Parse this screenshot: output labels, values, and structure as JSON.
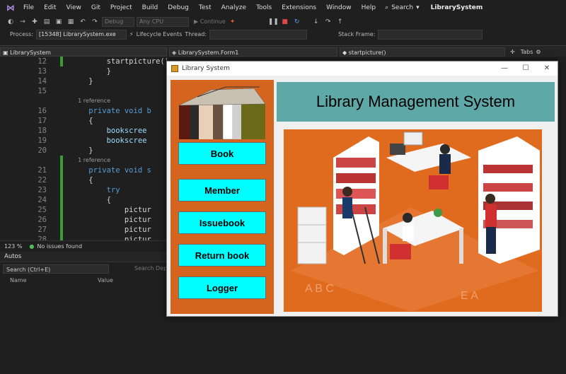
{
  "menu": {
    "items": [
      "File",
      "Edit",
      "View",
      "Git",
      "Project",
      "Build",
      "Debug",
      "Test",
      "Analyze",
      "Tools",
      "Extensions",
      "Window",
      "Help"
    ],
    "search_label": "Search",
    "solution_name": "LibrarySystem"
  },
  "toolbar": {
    "config": "Debug",
    "platform": "Any CPU",
    "continue_label": "Continue",
    "process_label": "Process:",
    "process_value": "[15348] LibrarySystem.exe",
    "lifecycle_label": "Lifecycle Events",
    "thread_label": "Thread:",
    "stackframe_label": "Stack Frame:"
  },
  "editor": {
    "project_combo": "LibrarySystem",
    "class_combo": "LibrarySystem.Form1",
    "member_combo": "startpicture()",
    "tabs_label": "Tabs",
    "lines": [
      {
        "num": "12",
        "text": "        startpicture();",
        "kind": "plain"
      },
      {
        "num": "13",
        "text": "        }",
        "kind": "plain"
      },
      {
        "num": "14",
        "text": "    }",
        "kind": "plain"
      },
      {
        "num": "15",
        "text": "",
        "kind": "plain"
      },
      {
        "num": "",
        "text": "    1 reference",
        "kind": "ref"
      },
      {
        "num": "16",
        "text": "    private void b",
        "kind": "kw"
      },
      {
        "num": "17",
        "text": "    {",
        "kind": "plain"
      },
      {
        "num": "18",
        "text": "        bookscree",
        "kind": "id"
      },
      {
        "num": "19",
        "text": "        bookscree",
        "kind": "id"
      },
      {
        "num": "20",
        "text": "    }",
        "kind": "plain"
      },
      {
        "num": "",
        "text": "    1 reference",
        "kind": "ref"
      },
      {
        "num": "21",
        "text": "    private void s",
        "kind": "kw"
      },
      {
        "num": "22",
        "text": "    {",
        "kind": "plain"
      },
      {
        "num": "23",
        "text": "        try",
        "kind": "kw"
      },
      {
        "num": "24",
        "text": "        {",
        "kind": "plain"
      },
      {
        "num": "25",
        "text": "            pictur",
        "kind": "plain"
      },
      {
        "num": "26",
        "text": "            pictur",
        "kind": "plain"
      },
      {
        "num": "27",
        "text": "            pictur",
        "kind": "plain"
      },
      {
        "num": "28",
        "text": "            pictur",
        "kind": "plain"
      }
    ]
  },
  "status": {
    "zoom": "123 %",
    "issues": "No issues found"
  },
  "autos": {
    "title": "Autos",
    "search_placeholder": "Search (Ctrl+E)",
    "search_depth": "Search Dept",
    "col_name": "Name",
    "col_value": "Value"
  },
  "app": {
    "window_title": "Library System",
    "header_title": "Library Management System",
    "buttons": [
      "Book",
      "Member",
      "Issuebook",
      "Return book",
      "Logger"
    ],
    "colors": {
      "left_panel": "#d4641e",
      "button_bg": "#00ffff",
      "header_bg": "#5fa8a8",
      "illustration_bg": "#e06a1e"
    }
  }
}
